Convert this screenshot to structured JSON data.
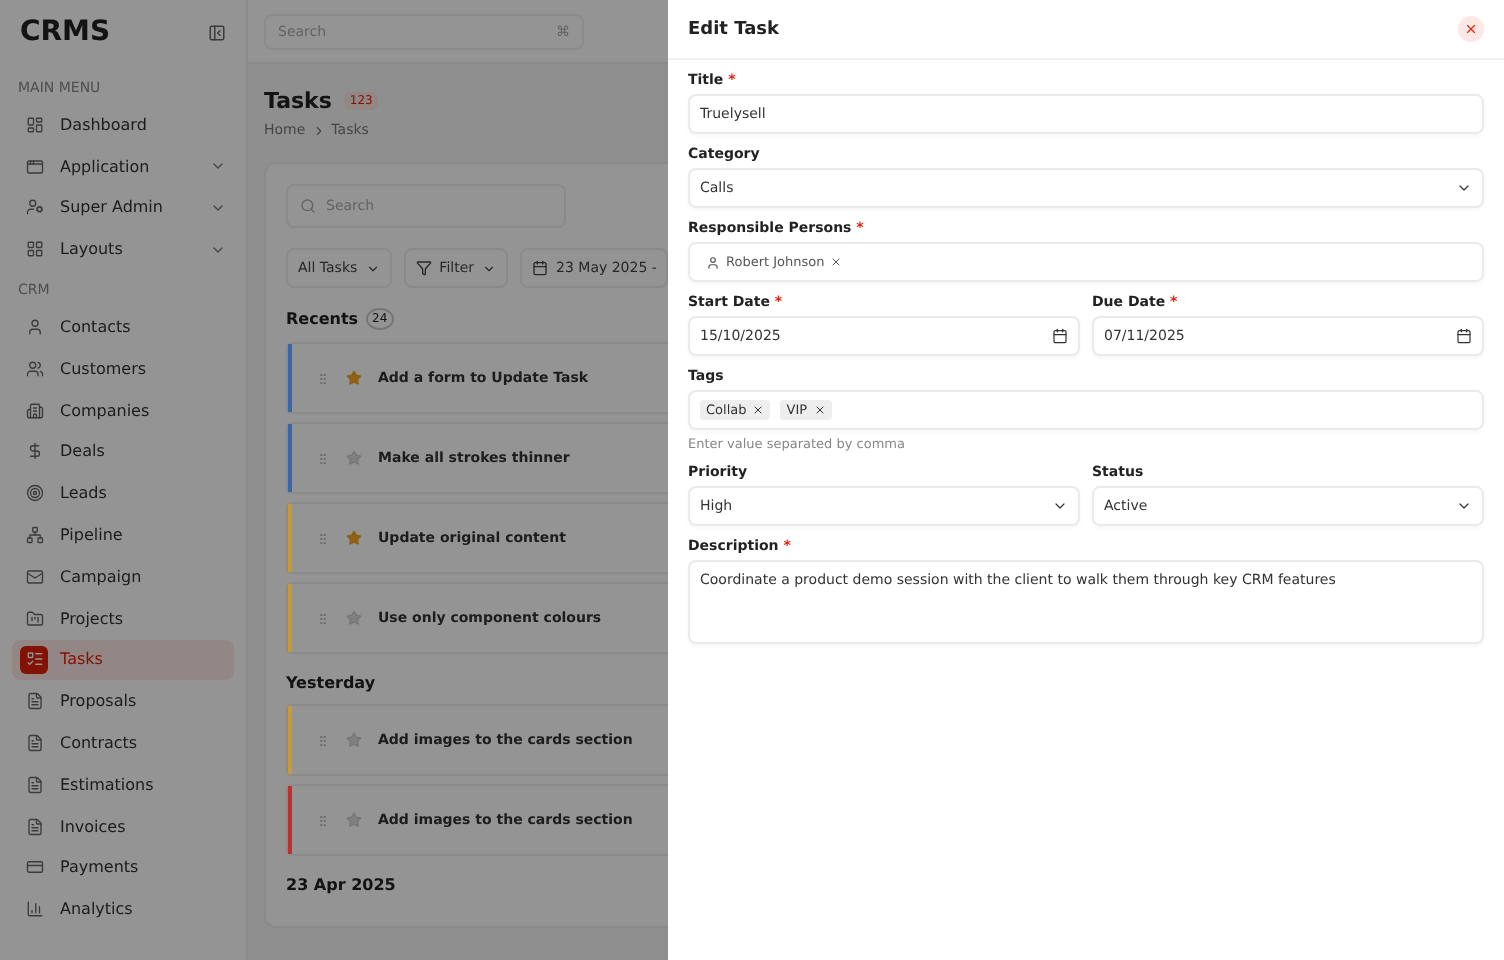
{
  "brand": {
    "name": "CRMS"
  },
  "topbar": {
    "search_placeholder": "Search",
    "shortcut": "⌘"
  },
  "sidebar": {
    "sections": [
      {
        "title": "MAIN MENU",
        "items": [
          {
            "label": "Dashboard",
            "expandable": false,
            "selected": false
          },
          {
            "label": "Application",
            "expandable": true,
            "selected": false
          },
          {
            "label": "Super Admin",
            "expandable": true,
            "selected": false
          },
          {
            "label": "Layouts",
            "expandable": true,
            "selected": false
          }
        ]
      },
      {
        "title": "CRM",
        "items": [
          {
            "label": "Contacts",
            "expandable": false,
            "selected": false
          },
          {
            "label": "Customers",
            "expandable": false,
            "selected": false
          },
          {
            "label": "Companies",
            "expandable": false,
            "selected": false
          },
          {
            "label": "Deals",
            "expandable": false,
            "selected": false
          },
          {
            "label": "Leads",
            "expandable": false,
            "selected": false
          },
          {
            "label": "Pipeline",
            "expandable": false,
            "selected": false
          },
          {
            "label": "Campaign",
            "expandable": false,
            "selected": false
          },
          {
            "label": "Projects",
            "expandable": false,
            "selected": false
          },
          {
            "label": "Tasks",
            "expandable": false,
            "selected": true
          },
          {
            "label": "Proposals",
            "expandable": false,
            "selected": false
          },
          {
            "label": "Contracts",
            "expandable": false,
            "selected": false
          },
          {
            "label": "Estimations",
            "expandable": false,
            "selected": false
          },
          {
            "label": "Invoices",
            "expandable": false,
            "selected": false
          },
          {
            "label": "Payments",
            "expandable": false,
            "selected": false
          },
          {
            "label": "Analytics",
            "expandable": false,
            "selected": false
          }
        ]
      }
    ]
  },
  "page": {
    "title": "Tasks",
    "count": "123",
    "breadcrumb": [
      "Home",
      "Tasks"
    ],
    "search_placeholder": "Search",
    "filters": [
      {
        "label": "All Tasks",
        "kind": "dropdown"
      },
      {
        "label": "Filter",
        "kind": "filter"
      },
      {
        "label": "23 May 2025 -",
        "kind": "date"
      }
    ],
    "groups": [
      {
        "title": "Recents",
        "count": "24",
        "tasks": [
          {
            "text": "Add a form to Update Task",
            "starred": true,
            "color": "#3a66ad"
          },
          {
            "text": "Make all strokes thinner",
            "starred": false,
            "color": "#3a66ad"
          },
          {
            "text": "Update original content",
            "starred": true,
            "color": "#c99a33"
          },
          {
            "text": "Use only component colours",
            "starred": false,
            "color": "#c99a33"
          }
        ]
      },
      {
        "title": "Yesterday",
        "tasks": [
          {
            "text": "Add images to the cards section",
            "starred": false,
            "color": "#c99a33"
          },
          {
            "text": "Add images to the cards section",
            "starred": false,
            "color": "#bf2f2f"
          }
        ]
      },
      {
        "title": "23 Apr 2025"
      }
    ]
  },
  "drawer": {
    "title": "Edit Task",
    "fields": [
      {
        "kind": "text",
        "label": "Title",
        "required_mark": "*",
        "value": "Truelysell"
      },
      {
        "kind": "select",
        "label": "Category",
        "value": "Calls"
      },
      {
        "kind": "people",
        "label": "Responsible Persons",
        "required_mark": "*",
        "chips": [
          "Robert Johnson"
        ]
      },
      {
        "kind": "row",
        "fields": [
          {
            "kind": "date",
            "label": "Start Date",
            "required_mark": "*",
            "value": "15/10/2025"
          },
          {
            "kind": "date",
            "label": "Due Date",
            "required_mark": "*",
            "value": "07/11/2025"
          }
        ]
      },
      {
        "kind": "tags",
        "label": "Tags",
        "chips": [
          "Collab",
          "VIP"
        ],
        "hint": "Enter value separated by comma"
      },
      {
        "kind": "row",
        "fields": [
          {
            "kind": "select",
            "label": "Priority",
            "value": "High"
          },
          {
            "kind": "select",
            "label": "Status",
            "value": "Active"
          }
        ]
      },
      {
        "kind": "textarea",
        "label": "Description",
        "required_mark": "*",
        "value": "Coordinate a product demo session with the client to walk them through key CRM features"
      }
    ]
  }
}
